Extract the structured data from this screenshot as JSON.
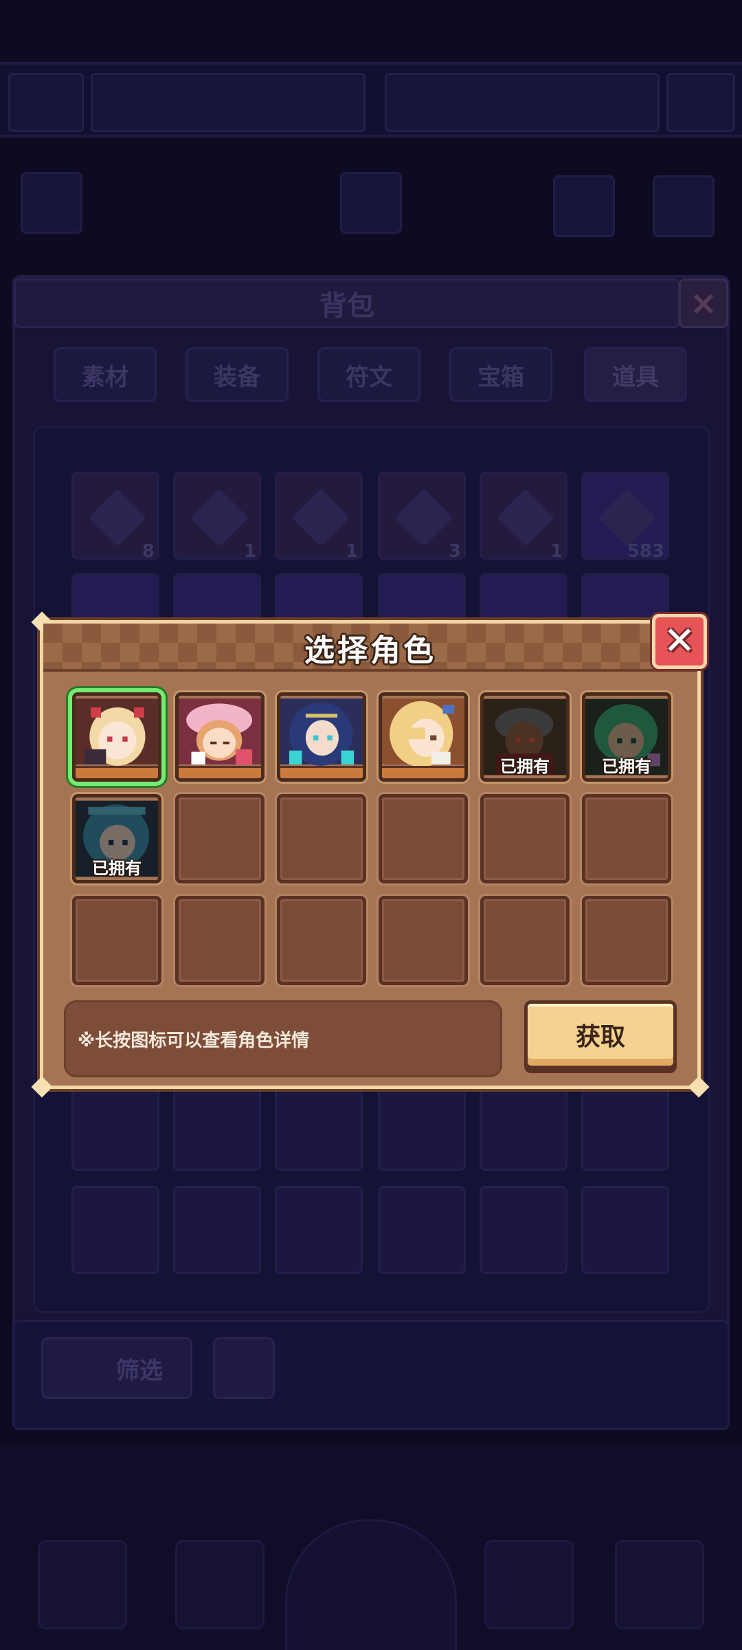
{
  "background": {
    "panel_title": "背包",
    "tabs": [
      {
        "label": "素材"
      },
      {
        "label": "装备"
      },
      {
        "label": "符文"
      },
      {
        "label": "宝箱"
      },
      {
        "label": "道具"
      }
    ],
    "item_counts": [
      "8",
      "1",
      "1",
      "3",
      "1",
      "583"
    ],
    "filter_label": "筛选"
  },
  "dialog": {
    "title": "选择角色",
    "close_icon": "close-icon",
    "characters": [
      {
        "id": "char-1",
        "owned_label": "",
        "selected": true
      },
      {
        "id": "char-2",
        "owned_label": "",
        "selected": false
      },
      {
        "id": "char-3",
        "owned_label": "",
        "selected": false
      },
      {
        "id": "char-4",
        "owned_label": "",
        "selected": false
      },
      {
        "id": "char-5",
        "owned_label": "已拥有",
        "selected": false
      },
      {
        "id": "char-6",
        "owned_label": "已拥有",
        "selected": false
      },
      {
        "id": "char-7",
        "owned_label": "已拥有",
        "selected": false
      }
    ],
    "hint": "※长按图标可以查看角色详情",
    "get_button": "获取"
  },
  "colors": {
    "selected_border": "#74ec73",
    "dialog_bg": "#a47454",
    "close_bg": "#e65458",
    "button_bg": "#f4d390"
  }
}
